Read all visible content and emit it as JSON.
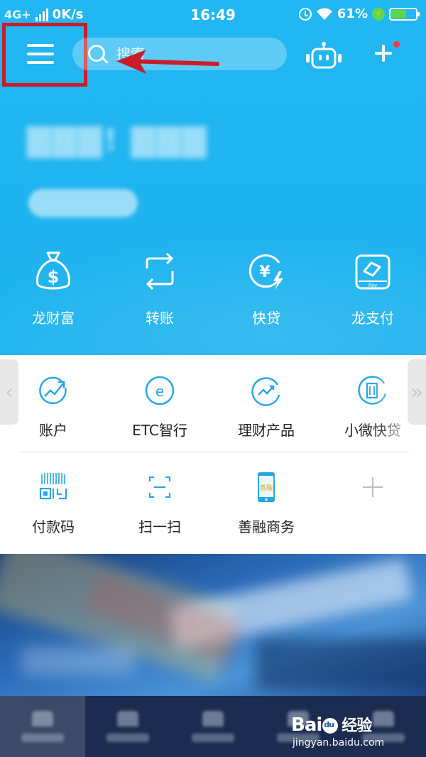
{
  "status_bar": {
    "network": "4G+",
    "speed": "0K/s",
    "time": "16:49",
    "battery_percent": "61%",
    "battery_level": 0.61
  },
  "top_bar": {
    "search_placeholder": "搜索"
  },
  "hero_actions": [
    {
      "label": "龙财富",
      "icon": "money-bag-icon"
    },
    {
      "label": "转账",
      "icon": "transfer-icon"
    },
    {
      "label": "快贷",
      "icon": "quick-loan-icon"
    },
    {
      "label": "龙支付",
      "icon": "long-pay-icon"
    }
  ],
  "grid_row_1": [
    {
      "label": "账户",
      "icon": "account-icon"
    },
    {
      "label": "ETC智行",
      "icon": "etc-icon"
    },
    {
      "label": "理财产品",
      "icon": "wealth-products-icon"
    },
    {
      "label": "小微快贷",
      "icon": "small-business-loan-icon"
    }
  ],
  "grid_row_2": [
    {
      "label": "付款码",
      "icon": "payment-code-icon"
    },
    {
      "label": "扫一扫",
      "icon": "scan-icon"
    },
    {
      "label": "善融商务",
      "icon": "e-commerce-icon"
    },
    {
      "label": "",
      "icon": "add-icon"
    }
  ],
  "watermark": {
    "brand": "Bai经验",
    "paw": "du",
    "url": "jingyan.baidu.com"
  },
  "colors": {
    "header_blue": "#1fb3ef",
    "icon_blue": "#27a7e0",
    "highlight_red": "#c81e2a",
    "nav_bg": "#1c2c50"
  }
}
